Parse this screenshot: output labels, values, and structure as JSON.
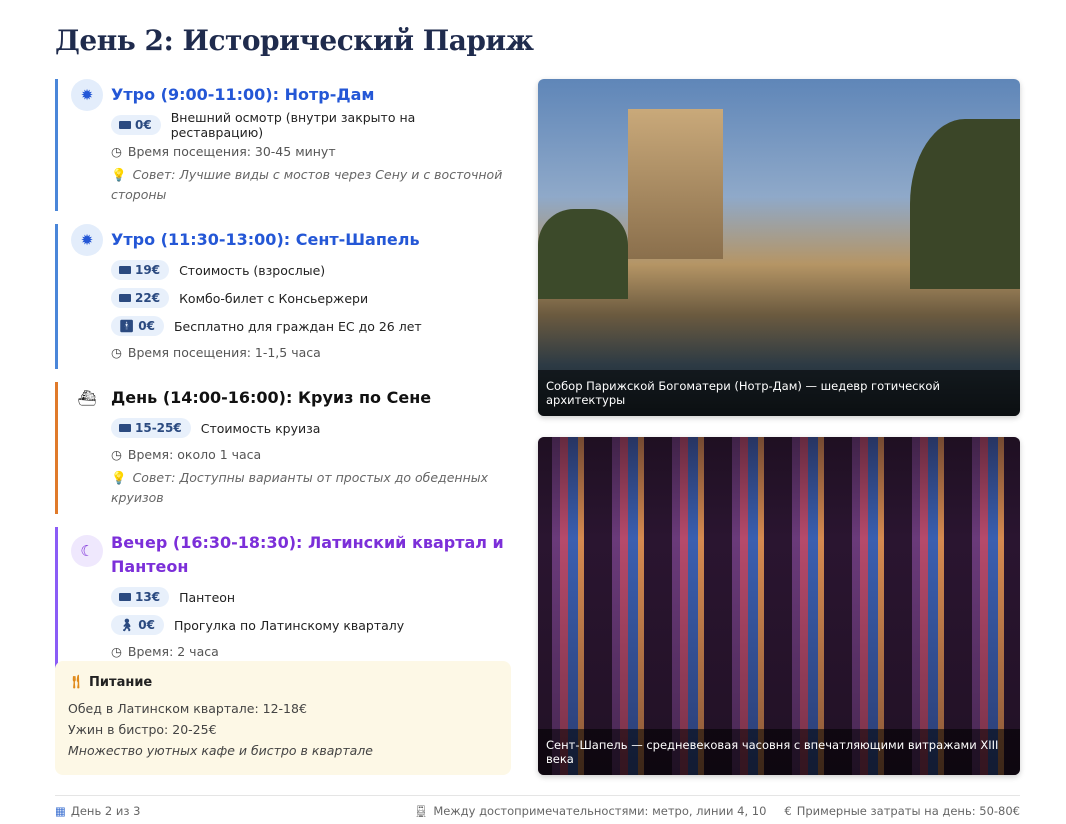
{
  "title": "День 2: Исторический Париж",
  "sections": [
    {
      "title": "Утро (9:00-11:00): Нотр-Дам",
      "icon": "sun-icon",
      "accent": "#4a86d9",
      "costs": [
        {
          "icon": "ticket-icon",
          "price": "0€",
          "label": "Внешний осмотр (внутри закрыто на реставрацию)"
        }
      ],
      "time": "Время посещения: 30-45 минут",
      "tip_label": "Совет:",
      "tip": "Лучшие виды с мостов через Сену и с восточной стороны"
    },
    {
      "title": "Утро (11:30-13:00): Сент-Шапель",
      "icon": "sun-icon",
      "accent": "#4a86d9",
      "costs": [
        {
          "icon": "ticket-icon",
          "price": "19€",
          "label": "Стоимость (взрослые)"
        },
        {
          "icon": "ticket-icon",
          "price": "22€",
          "label": "Комбо-билет с Консьержери"
        },
        {
          "icon": "person-icon",
          "price": "0€",
          "label": "Бесплатно для граждан ЕС до 26 лет"
        }
      ],
      "time": "Время посещения: 1-1,5 часа"
    },
    {
      "title": "День (14:00-16:00): Круиз по Сене",
      "icon": "ship-icon",
      "accent": "#e07a2a",
      "costs": [
        {
          "icon": "ticket-icon",
          "price": "15-25€",
          "label": "Стоимость круиза"
        }
      ],
      "time": "Время: около 1 часа",
      "tip_label": "Совет:",
      "tip": "Доступны варианты от простых до обеденных круизов"
    },
    {
      "title": "Вечер (16:30-18:30): Латинский квартал и Пантеон",
      "icon": "moon-icon",
      "accent": "#8b5cf6",
      "costs": [
        {
          "icon": "ticket-icon",
          "price": "13€",
          "label": "Пантеон"
        },
        {
          "icon": "walking-icon",
          "price": "0€",
          "label": "Прогулка по Латинскому кварталу"
        }
      ],
      "time": "Время: 2 часа"
    }
  ],
  "food": {
    "title": "Питание",
    "lines": [
      "Обед в Латинском квартале: 12-18€",
      "Ужин в бистро: 20-25€"
    ],
    "note": "Множество уютных кафе и бистро в квартале"
  },
  "images": [
    {
      "caption": "Собор Парижской Богоматери (Нотр-Дам) — шедевр готической архитектуры"
    },
    {
      "caption": "Сент-Шапель — средневековая часовня с впечатляющими витражами XIII века"
    }
  ],
  "footer": {
    "day": "День 2 из 3",
    "transport": "Между достопримечательностями: метро, линии 4, 10",
    "budget": "Примерные затраты на день: 50-80€"
  }
}
